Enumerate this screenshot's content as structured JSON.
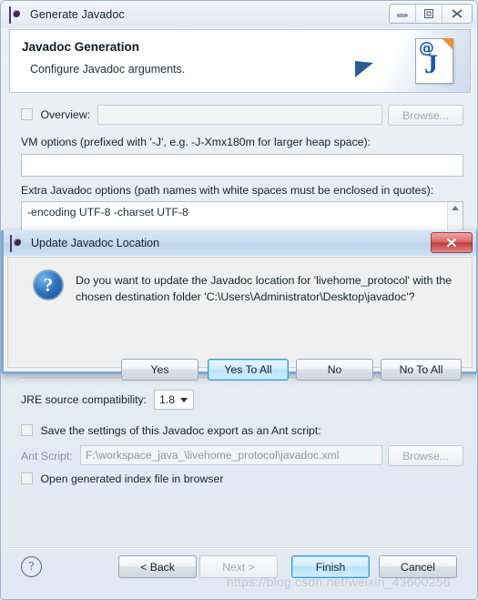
{
  "window": {
    "title": "Generate Javadoc",
    "app_icon": "eclipse-icon",
    "controls": {
      "minimize": "–",
      "restore": "▣",
      "close": "✕"
    }
  },
  "banner": {
    "title": "Javadoc Generation",
    "subtitle": "Configure Javadoc arguments.",
    "art_icon": "javadoc-page-icon",
    "art_at": "@",
    "art_j": "J"
  },
  "form": {
    "overview": {
      "label": "Overview:",
      "checked": false,
      "value": "",
      "browse_label": "Browse..."
    },
    "vm_options": {
      "label": "VM options (prefixed with '-J', e.g. -J-Xmx180m for larger heap space):",
      "value": ""
    },
    "extra_options": {
      "label": "Extra Javadoc options (path names with white spaces must be enclosed in quotes):",
      "value": "-encoding UTF-8 -charset UTF-8"
    },
    "jre": {
      "label": "JRE source compatibility:",
      "value": "1.8"
    },
    "ant_save": {
      "label": "Save the settings of this Javadoc export as an Ant script:",
      "checked": false
    },
    "ant_script": {
      "label": "Ant Script:",
      "value": "F:\\workspace_java_\\livehome_protocol\\javadoc.xml",
      "browse_label": "Browse..."
    },
    "open_index": {
      "label": "Open generated index file in browser",
      "checked": false
    }
  },
  "footer": {
    "help_icon": "question-mark-icon",
    "help_glyph": "?",
    "back_label": "< Back",
    "next_label": "Next >",
    "finish_label": "Finish",
    "cancel_label": "Cancel"
  },
  "watermark": {
    "text": "https://blog.csdn.net/weixin_43600256"
  },
  "modal": {
    "title": "Update Javadoc Location",
    "icon": "eclipse-icon",
    "close_glyph": "✕",
    "question_icon": "question-mark-icon",
    "question_glyph": "?",
    "message": "Do you want to update the Javadoc location for 'livehome_protocol' with the chosen destination folder 'C:\\Users\\Administrator\\Desktop\\javadoc'?",
    "buttons": {
      "yes": "Yes",
      "yes_to_all": "Yes To All",
      "no": "No",
      "no_to_all": "No To All"
    }
  },
  "colors": {
    "focus_blue": "#3c9ad6",
    "close_red": "#bf3d3d",
    "accent_blue": "#1d5ba6"
  }
}
